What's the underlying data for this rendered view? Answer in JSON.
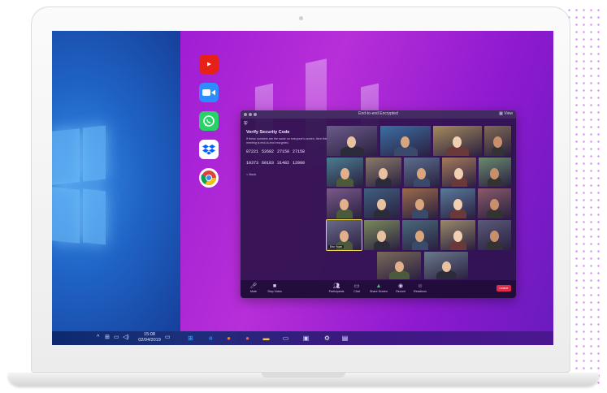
{
  "desktop_apps": [
    {
      "name": "youtube-icon",
      "color": "#e62117"
    },
    {
      "name": "zoom-app-icon",
      "color": "#2d8cff"
    },
    {
      "name": "whatsapp-icon",
      "color": "#25d366"
    },
    {
      "name": "dropbox-icon",
      "color": "#0061fe"
    },
    {
      "name": "chrome-icon",
      "color": "#ffffff"
    }
  ],
  "taskbar": {
    "clock_time": "15:08",
    "clock_date": "02/04/2019",
    "pinned": [
      "windows-start-icon",
      "edge-icon",
      "firefox-icon",
      "firefox-alt-icon",
      "file-explorer-icon",
      "video-app-icon",
      "photos-icon",
      "settings-icon",
      "store-icon"
    ]
  },
  "zoom": {
    "title": "End-to-end Encrypted",
    "view_label": "View",
    "verify": {
      "heading": "Verify Security Code",
      "description": "If these numbers are the same on everyone's screen, then this meeting is end-to-end encrypted.",
      "codes_row1": [
        "87221",
        "52682",
        "27158",
        "27158"
      ],
      "codes_row2": [
        "10373",
        "60183",
        "31482",
        "12980"
      ],
      "back_label": "< Back"
    },
    "name_tag": "Eric Yuan",
    "toolbar": [
      {
        "name": "mute",
        "icon": "microphone-icon",
        "label": "Mute"
      },
      {
        "name": "stop-video",
        "icon": "video-camera-icon",
        "label": "Stop Video"
      },
      {
        "name": "participants",
        "icon": "participants-icon",
        "label": "Participants"
      },
      {
        "name": "chat",
        "icon": "chat-icon",
        "label": "Chat"
      },
      {
        "name": "share-screen",
        "icon": "share-screen-icon",
        "label": "Share Screen"
      },
      {
        "name": "record",
        "icon": "record-icon",
        "label": "Record"
      },
      {
        "name": "reactions",
        "icon": "reactions-icon",
        "label": "Reactions"
      }
    ],
    "leave_label": "Leave"
  }
}
